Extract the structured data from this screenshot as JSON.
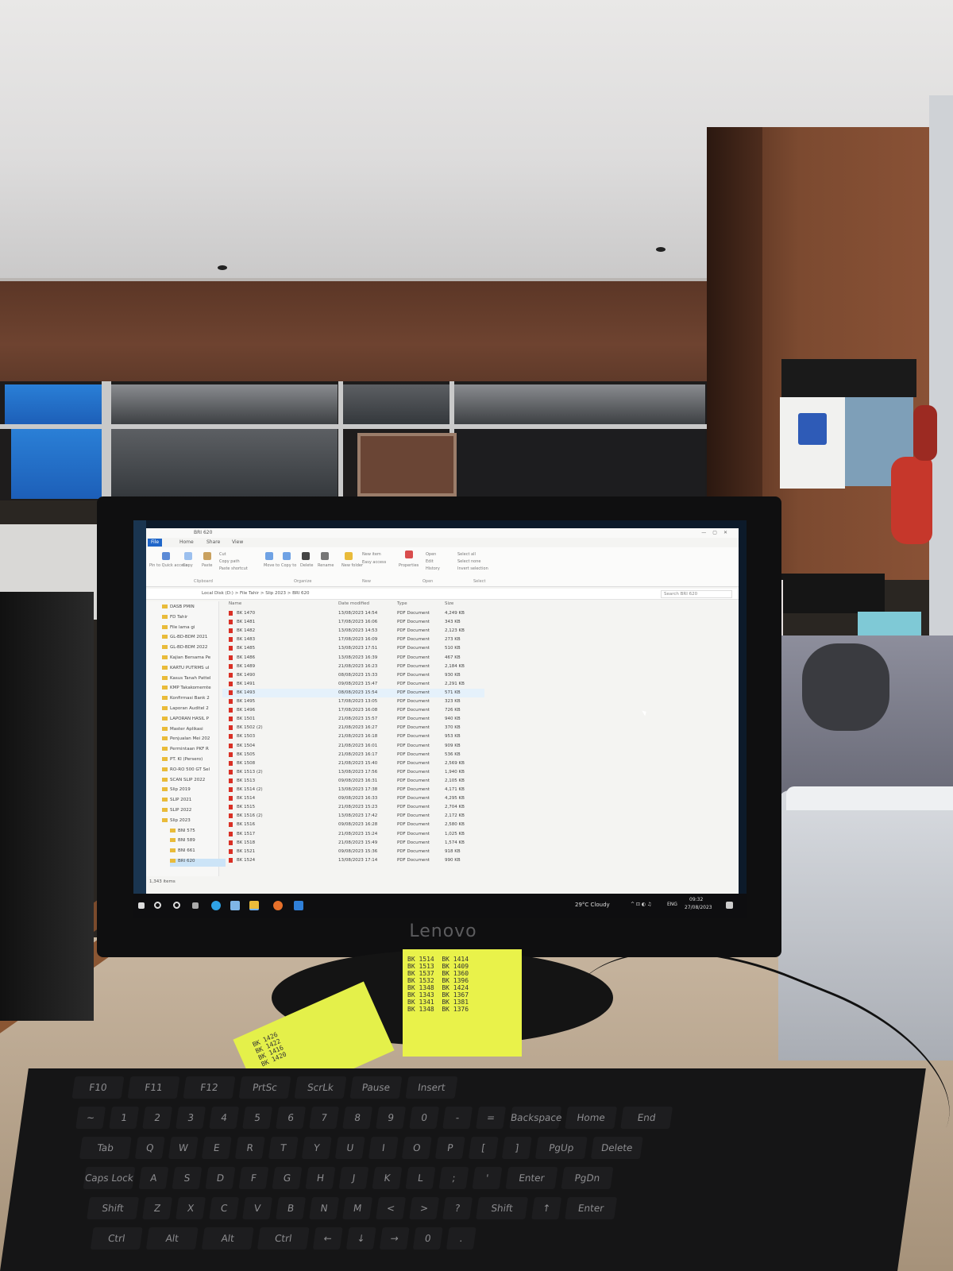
{
  "explorer": {
    "title": "BRI 620",
    "tabs": [
      "File",
      "Home",
      "Share",
      "View"
    ],
    "ribbon_groups": [
      "Clipboard",
      "Organize",
      "New",
      "Open",
      "Select"
    ],
    "ribbon_labels": {
      "pin": "Pin to Quick access",
      "copy": "Copy",
      "paste": "Paste",
      "cut": "Cut",
      "copy_path": "Copy path",
      "paste_shortcut": "Paste shortcut",
      "move_to": "Move to",
      "copy_to": "Copy to",
      "delete": "Delete",
      "rename": "Rename",
      "new_folder": "New folder",
      "new_item": "New item",
      "easy_access": "Easy access",
      "properties": "Properties",
      "open": "Open",
      "edit": "Edit",
      "history": "History",
      "select_all": "Select all",
      "select_none": "Select none",
      "invert_selection": "Invert selection"
    },
    "address": "Local Disk (D:)  >  File Tahir  >  Slip 2023  >  BRI 620",
    "search_placeholder": "Search BRI 620",
    "columns": [
      "Name",
      "Date modified",
      "Type",
      "Size"
    ],
    "nav_items": [
      "DASB PMIN",
      "FD Tahir",
      "File lama gi",
      "GL-BD-BDM 2021",
      "GL-BD-BDM 2022",
      "Kajian Bersama Pe",
      "KARTU PUTRMS ul",
      "Kasus Tanah Pattel",
      "KMP Takakomemte",
      "Konfirmasi Bank 2",
      "Laporan Auditel 2",
      "LAPORAN HASIL P",
      "Master Aplikasi",
      "Penjualan Mei 202",
      "Permintaan PKF R",
      "PT. KI (Persero)",
      "RO-RO 500 GT Sel",
      "SCAN SLIP 2022",
      "Slip 2019",
      "SLIP 2021",
      "SLIP 2022",
      "Slip 2023",
      "BNI 575",
      "BNI 589",
      "BNI 661",
      "BRI 620"
    ],
    "files": [
      {
        "name": "BK 1470",
        "date": "13/08/2023 14:54",
        "type": "PDF Document",
        "size": "4,249 KB"
      },
      {
        "name": "BK 1481",
        "date": "17/08/2023 16:06",
        "type": "PDF Document",
        "size": "343 KB"
      },
      {
        "name": "BK 1482",
        "date": "13/08/2023 14:53",
        "type": "PDF Document",
        "size": "2,123 KB"
      },
      {
        "name": "BK 1483",
        "date": "17/08/2023 16:09",
        "type": "PDF Document",
        "size": "273 KB"
      },
      {
        "name": "BK 1485",
        "date": "13/08/2023 17:51",
        "type": "PDF Document",
        "size": "510 KB"
      },
      {
        "name": "BK 1486",
        "date": "13/08/2023 16:39",
        "type": "PDF Document",
        "size": "467 KB"
      },
      {
        "name": "BK 1489",
        "date": "21/08/2023 16:23",
        "type": "PDF Document",
        "size": "2,184 KB"
      },
      {
        "name": "BK 1490",
        "date": "08/08/2023 15:33",
        "type": "PDF Document",
        "size": "930 KB"
      },
      {
        "name": "BK 1491",
        "date": "09/08/2023 15:47",
        "type": "PDF Document",
        "size": "2,291 KB"
      },
      {
        "name": "BK 1493",
        "date": "08/08/2023 15:54",
        "type": "PDF Document",
        "size": "571 KB"
      },
      {
        "name": "BK 1495",
        "date": "17/08/2023 13:05",
        "type": "PDF Document",
        "size": "323 KB"
      },
      {
        "name": "BK 1496",
        "date": "17/08/2023 16:08",
        "type": "PDF Document",
        "size": "726 KB"
      },
      {
        "name": "BK 1501",
        "date": "21/08/2023 15:57",
        "type": "PDF Document",
        "size": "940 KB"
      },
      {
        "name": "BK 1502 (2)",
        "date": "21/08/2023 16:27",
        "type": "PDF Document",
        "size": "370 KB"
      },
      {
        "name": "BK 1503",
        "date": "21/08/2023 16:18",
        "type": "PDF Document",
        "size": "953 KB"
      },
      {
        "name": "BK 1504",
        "date": "21/08/2023 16:01",
        "type": "PDF Document",
        "size": "909 KB"
      },
      {
        "name": "BK 1505",
        "date": "21/08/2023 16:17",
        "type": "PDF Document",
        "size": "536 KB"
      },
      {
        "name": "BK 1508",
        "date": "21/08/2023 15:40",
        "type": "PDF Document",
        "size": "2,569 KB"
      },
      {
        "name": "BK 1513 (2)",
        "date": "13/08/2023 17:56",
        "type": "PDF Document",
        "size": "1,940 KB"
      },
      {
        "name": "BK 1513",
        "date": "09/08/2023 16:31",
        "type": "PDF Document",
        "size": "2,105 KB"
      },
      {
        "name": "BK 1514 (2)",
        "date": "13/08/2023 17:38",
        "type": "PDF Document",
        "size": "4,171 KB"
      },
      {
        "name": "BK 1514",
        "date": "09/08/2023 16:33",
        "type": "PDF Document",
        "size": "4,295 KB"
      },
      {
        "name": "BK 1515",
        "date": "21/08/2023 15:23",
        "type": "PDF Document",
        "size": "2,704 KB"
      },
      {
        "name": "BK 1516 (2)",
        "date": "13/08/2023 17:42",
        "type": "PDF Document",
        "size": "2,172 KB"
      },
      {
        "name": "BK 1516",
        "date": "09/08/2023 16:28",
        "type": "PDF Document",
        "size": "2,580 KB"
      },
      {
        "name": "BK 1517",
        "date": "21/08/2023 15:24",
        "type": "PDF Document",
        "size": "1,025 KB"
      },
      {
        "name": "BK 1518",
        "date": "21/08/2023 15:49",
        "type": "PDF Document",
        "size": "1,574 KB"
      },
      {
        "name": "BK 1521",
        "date": "09/08/2023 15:36",
        "type": "PDF Document",
        "size": "918 KB"
      },
      {
        "name": "BK 1524",
        "date": "13/08/2023 17:14",
        "type": "PDF Document",
        "size": "990 KB"
      }
    ],
    "status": "1,343 items"
  },
  "taskbar": {
    "weather": "29°C  Cloudy",
    "language": "ENG",
    "time": "09:32",
    "date": "27/08/2023"
  },
  "monitor": {
    "brand": "Lenovo"
  },
  "sticky_notes": {
    "note1": "BK 1514  BK 1414\nBK 1513  BK 1409\nBK 1537  BK 1360\nBK 1532  BK 1396\nBK 1348  BK 1424\nBK 1343  BK 1367\nBK 1341  BK 1381\nBK 1348  BK 1376",
    "note2": "BK 1426\nBK 1422\nBK 1416\nBK 1420"
  },
  "keyboard": {
    "row1": [
      "F10",
      "F11",
      "F12",
      "PrtSc",
      "ScrLk",
      "Pause",
      "Insert"
    ],
    "row2": [
      "~",
      "1",
      "2",
      "3",
      "4",
      "5",
      "6",
      "7",
      "8",
      "9",
      "0",
      "-",
      "=",
      "Backspace",
      "Home",
      "End"
    ],
    "row3": [
      "Tab",
      "Q",
      "W",
      "E",
      "R",
      "T",
      "Y",
      "U",
      "I",
      "O",
      "P",
      "[",
      "]",
      "PgUp",
      "Delete"
    ],
    "row4": [
      "Caps Lock",
      "A",
      "S",
      "D",
      "F",
      "G",
      "H",
      "J",
      "K",
      "L",
      ";",
      "'",
      "Enter",
      "PgDn"
    ],
    "row5": [
      "Shift",
      "Z",
      "X",
      "C",
      "V",
      "B",
      "N",
      "M",
      "<",
      ">",
      "?",
      "Shift",
      "↑",
      "Enter"
    ],
    "row6": [
      "Ctrl",
      "Alt",
      "Alt",
      "Ctrl",
      "←",
      "↓",
      "→",
      "0",
      "."
    ]
  }
}
